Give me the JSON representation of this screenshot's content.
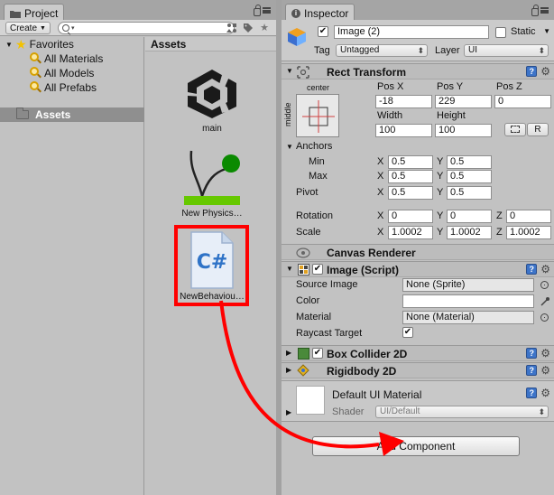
{
  "project": {
    "tab_label": "Project",
    "create_label": "Create",
    "search_placeholder": "",
    "favorites": {
      "label": "Favorites",
      "items": [
        {
          "label": "All Materials"
        },
        {
          "label": "All Models"
        },
        {
          "label": "All Prefabs"
        }
      ]
    },
    "assets_tree_label": "Assets",
    "assets_header": "Assets",
    "assets": [
      {
        "name": "main"
      },
      {
        "name": "New Physics…"
      },
      {
        "name": "NewBehaviou…"
      }
    ]
  },
  "inspector": {
    "tab_label": "Inspector",
    "object_name": "Image (2)",
    "static_label": "Static",
    "tag_label": "Tag",
    "tag_value": "Untagged",
    "layer_label": "Layer",
    "layer_value": "UI",
    "rect_transform": {
      "title": "Rect Transform",
      "anchor_h": "center",
      "anchor_v": "middle",
      "pos_x_label": "Pos X",
      "pos_y_label": "Pos Y",
      "pos_z_label": "Pos Z",
      "pos_x": "-18",
      "pos_y": "229",
      "pos_z": "0",
      "width_label": "Width",
      "height_label": "Height",
      "width": "100",
      "height": "100",
      "raw_button": "R",
      "anchors_label": "Anchors",
      "min_label": "Min",
      "max_label": "Max",
      "x_label": "X",
      "y_label": "Y",
      "z_label": "Z",
      "min_x": "0.5",
      "min_y": "0.5",
      "max_x": "0.5",
      "max_y": "0.5",
      "pivot_label": "Pivot",
      "pivot_x": "0.5",
      "pivot_y": "0.5",
      "rotation_label": "Rotation",
      "rot_x": "0",
      "rot_y": "0",
      "rot_z": "0",
      "scale_label": "Scale",
      "scale_x": "1.0002",
      "scale_y": "1.0002",
      "scale_z": "1.0002"
    },
    "canvas_renderer": {
      "title": "Canvas Renderer"
    },
    "image_script": {
      "title": "Image (Script)",
      "source_image_label": "Source Image",
      "source_image_value": "None (Sprite)",
      "color_label": "Color",
      "material_label": "Material",
      "material_value": "None (Material)",
      "raycast_label": "Raycast Target"
    },
    "box_collider": {
      "title": "Box Collider 2D"
    },
    "rigidbody": {
      "title": "Rigidbody 2D"
    },
    "material": {
      "name": "Default UI Material",
      "shader_label": "Shader",
      "shader_value": "UI/Default"
    },
    "add_component_label": "Add Component"
  },
  "colors": {
    "highlight": "#ff0000",
    "selection": "#8f8f8f",
    "unity_green": "#66c800"
  }
}
